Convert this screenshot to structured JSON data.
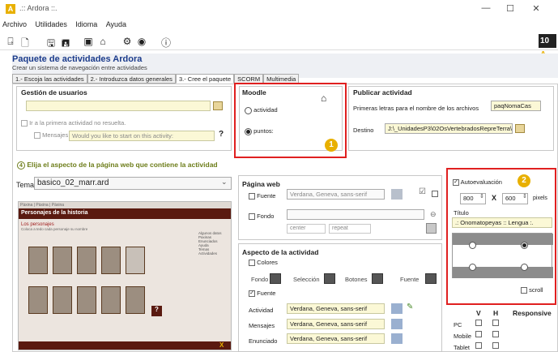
{
  "window": {
    "title": ".:: Ardora ::.",
    "minimize": "—",
    "maximize": "☐",
    "close": "✕"
  },
  "menu": [
    "Archivo",
    "Utilidades",
    "Idioma",
    "Ayuda"
  ],
  "header": {
    "title": "Paquete de actividades Ardora",
    "subtitle": "Crear un sistema de navegación entre actividades"
  },
  "tabs": [
    "1.- Escoja las actividades",
    "2.- Introduzca datos generales",
    "3.- Cree el paquete",
    "SCORM",
    "Multimedia"
  ],
  "gestion": {
    "title": "Gestión de usuarios",
    "first_unsolved": "Ir a la primera actividad no resuelta.",
    "messages": "Mensajes",
    "messages_placeholder": "Would you like to start on this activity:",
    "help": "?"
  },
  "moodle": {
    "title": "Moodle",
    "option_activity": "actividad",
    "option_points": "puntos:",
    "selected": "puntos:",
    "badge": "1"
  },
  "publicar": {
    "title": "Publicar actividad",
    "first_letters_label": "Primeras letras para el nombre de los archivos",
    "first_letters_value": "paqNomaCas",
    "destino_label": "Destino",
    "destino_value": "J:\\_UnidadesP3\\02OsVertebradosRepreTerra\\"
  },
  "aspect": {
    "number": "4",
    "title": "Elija el aspecto de la página web que contiene la actividad",
    "tema_label": "Tema",
    "tema_value": "basico_02_marr.ard"
  },
  "preview": {
    "tabs": [
      "Pàxina",
      "Pàxina",
      "Pàxina"
    ],
    "title": "Personajes de la historia",
    "section": "Los personajes",
    "desc": "Coloca a tedo cada personaje su nombre",
    "sidebar_title": "Algunos datos",
    "sidebar": [
      "Paxinas",
      "Enunciados",
      "Ayuda",
      "Temas"
    ],
    "sidebar2": "Actividades",
    "help": "?",
    "footer_close": "X"
  },
  "pagina_web": {
    "title": "Página web",
    "fuente": "Fuente",
    "font_value": "Verdana, Geneva, sans-serif",
    "fondo": "Fondo",
    "align": "center",
    "repeat": "repeat"
  },
  "aspecto_actividad": {
    "title": "Aspecto de la actividad",
    "colores": "Colores",
    "fondo": "Fondo",
    "seleccion": "Selección",
    "botones": "Botones",
    "fuente_color": "Fuente",
    "fuente": "Fuente",
    "rows": [
      {
        "label": "Actividad",
        "value": "Verdana, Geneva, sans-serif"
      },
      {
        "label": "Mensajes",
        "value": "Verdana, Geneva, sans-serif"
      },
      {
        "label": "Enunciado",
        "value": "Verdana, Geneva, sans-serif"
      }
    ]
  },
  "autoeval": {
    "label": "Autoevaluación",
    "checked": true,
    "badge": "2",
    "width": "800",
    "height": "600",
    "times": "X",
    "unit": "pixels",
    "titulo_label": "Título",
    "titulo_value": ".: Onomatopeyas :: Lengua :.",
    "scroll": "scroll"
  },
  "responsive": {
    "col_v": "V",
    "col_h": "H",
    "title": "Responsive",
    "rows": [
      "PC",
      "Mobile",
      "Tablet"
    ]
  },
  "colors": {
    "accent": "#e8b000",
    "red": "#e02020",
    "heading": "#1b3b8b",
    "olive": "#6d7d1a"
  }
}
